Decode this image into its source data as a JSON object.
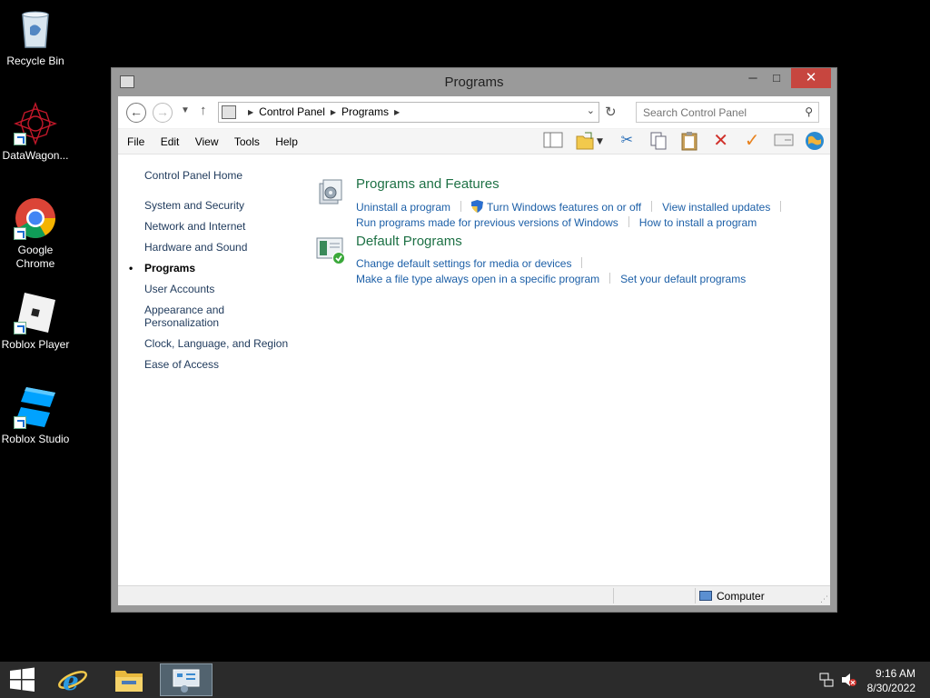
{
  "desktop": {
    "icons": [
      {
        "label": "Recycle Bin",
        "icon": "recycle-bin-icon"
      },
      {
        "label": "DataWagon...",
        "icon": "datawagon-icon"
      },
      {
        "label": "Google Chrome",
        "icon": "chrome-icon"
      },
      {
        "label": "Roblox Player",
        "icon": "roblox-player-icon"
      },
      {
        "label": "Roblox Studio",
        "icon": "roblox-studio-icon"
      }
    ]
  },
  "window": {
    "title": "Programs",
    "minimize": "─",
    "maximize": "□",
    "close": "✕"
  },
  "address": {
    "crumbs": [
      "Control Panel",
      "Programs"
    ],
    "search_placeholder": "Search Control Panel"
  },
  "menu": [
    "File",
    "Edit",
    "View",
    "Tools",
    "Help"
  ],
  "leftnav": {
    "home": "Control Panel Home",
    "items": [
      "System and Security",
      "Network and Internet",
      "Hardware and Sound",
      "Programs",
      "User Accounts",
      "Appearance and Personalization",
      "Clock, Language, and Region",
      "Ease of Access"
    ],
    "current": "Programs"
  },
  "categories": [
    {
      "title": "Programs and Features",
      "links_row1": [
        "Uninstall a program",
        "Turn Windows features on or off",
        "View installed updates"
      ],
      "links_row2": [
        "Run programs made for previous versions of Windows",
        "How to install a program"
      ]
    },
    {
      "title": "Default Programs",
      "links_row1": [
        "Change default settings for media or devices"
      ],
      "links_row2": [
        "Make a file type always open in a specific program",
        "Set your default programs"
      ]
    }
  ],
  "statusbar": {
    "location": "Computer"
  },
  "taskbar": {
    "time": "9:16 AM",
    "date": "8/30/2022"
  },
  "colors": {
    "accent_link": "#1c5fa7",
    "category_title": "#1e7145",
    "close_button": "#c7463f"
  }
}
